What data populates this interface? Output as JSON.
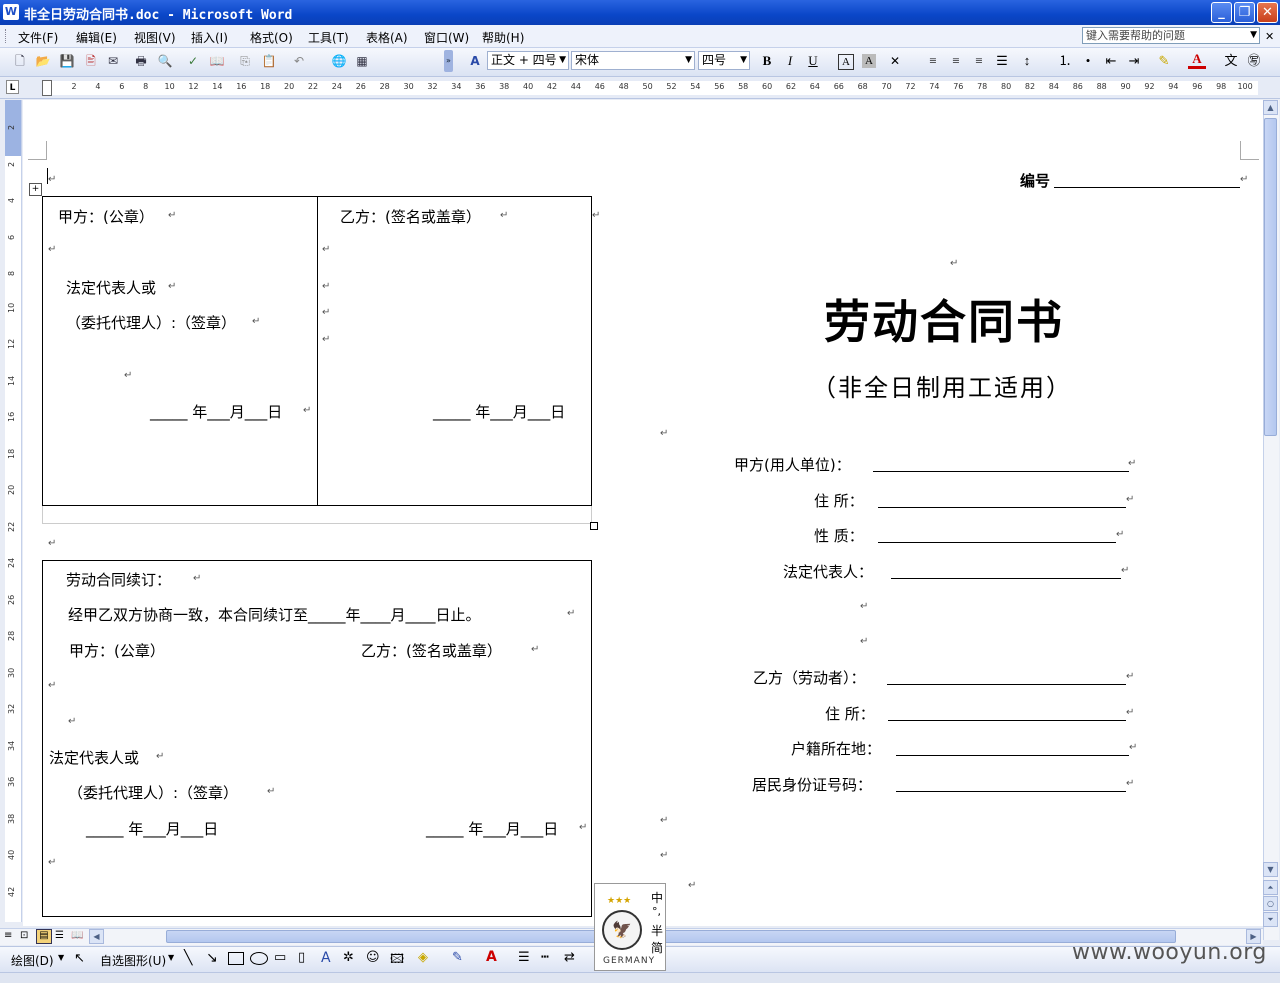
{
  "window": {
    "title": "非全日劳动合同书.doc - Microsoft Word",
    "app_icon": "W"
  },
  "menu": [
    "文件(F)",
    "编辑(E)",
    "视图(V)",
    "插入(I)",
    "格式(O)",
    "工具(T)",
    "表格(A)",
    "窗口(W)",
    "帮助(H)"
  ],
  "help_box": {
    "placeholder": "键入需要帮助的问题"
  },
  "toolbar": {
    "style_value": "正文 + 四号",
    "font_value": "宋体",
    "size_value": "四号",
    "bold": "B",
    "italic": "I",
    "underline": "U"
  },
  "ruler": {
    "ticks": [
      "2",
      "4",
      "6",
      "8",
      "10",
      "12",
      "14",
      "16",
      "18",
      "20",
      "22",
      "24",
      "26",
      "28",
      "30",
      "32",
      "34",
      "36",
      "38",
      "40",
      "42",
      "44",
      "46",
      "48",
      "50",
      "52",
      "54",
      "56",
      "58",
      "60",
      "62",
      "64",
      "66",
      "68",
      "70",
      "72",
      "74",
      "76",
      "78",
      "80",
      "82",
      "84",
      "86",
      "88",
      "90",
      "92",
      "94",
      "96",
      "98",
      "100"
    ],
    "vticks": [
      "2",
      "2",
      "4",
      "6",
      "8",
      "10",
      "12",
      "14",
      "16",
      "18",
      "20",
      "22",
      "24",
      "26",
      "28",
      "30",
      "32",
      "34",
      "36",
      "38",
      "40",
      "42"
    ]
  },
  "left_page": {
    "table1": {
      "party_a": "甲方：(公章）",
      "legal_rep": "法定代表人或",
      "agent": "（委托代理人）:（签章）",
      "date_left": "_____  年___月___日",
      "party_b": "乙方：(签名或盖章）",
      "date_right": "_____  年___月___日"
    },
    "table2": {
      "renewal_title": "劳动合同续订：",
      "renewal_text": "经甲乙双方协商一致，本合同续订至_____年____月____日止。",
      "party_a": "甲方：(公章）",
      "party_b": "乙方：(签名或盖章）",
      "legal_rep": "法定代表人或",
      "agent": "（委托代理人）:（签章）",
      "date_left": "_____  年___月___日",
      "date_right": "_____  年___月___日"
    }
  },
  "right_page": {
    "number_label": "编号",
    "title": "劳动合同书",
    "subtitle": "（非全日制用工适用）",
    "fields": [
      "甲方(用人单位)：",
      "住  所：",
      "性  质：",
      "法定代表人：",
      "乙方（劳动者）：",
      "住  所：",
      "户籍所在地：",
      "居民身份证号码："
    ]
  },
  "drawing_toolbar": {
    "draw_label": "绘图(D)",
    "autoshapes_label": "自选图形(U)"
  },
  "ime": {
    "chars": [
      "中",
      "°,",
      "半",
      "简"
    ],
    "brand": "GERMANY",
    "stars": "★★★"
  },
  "watermark": "www.wooyun.org"
}
